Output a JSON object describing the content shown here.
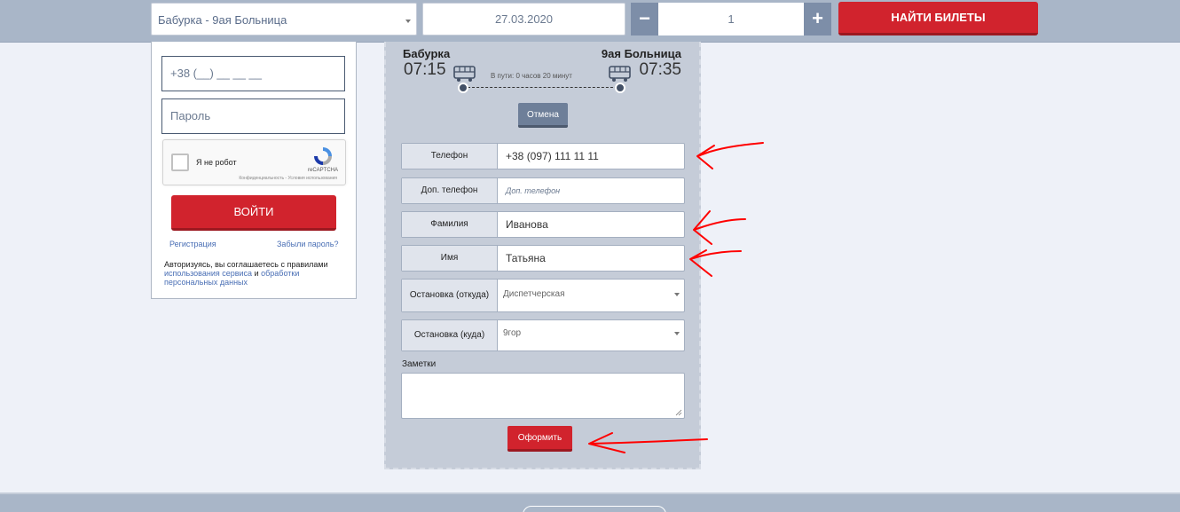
{
  "search": {
    "route": "Бабурка - 9ая Больница",
    "date": "27.03.2020",
    "quantity": "1",
    "minus": "−",
    "plus": "+",
    "find_label": "НАЙТИ БИЛЕТЫ"
  },
  "login": {
    "phone_placeholder": "+38 (__) __ __ __",
    "password_placeholder": "Пароль",
    "captcha_label": "Я не робот",
    "captcha_brand": "reCAPTCHA",
    "captcha_terms": "Конфиденциальность - Условия использования",
    "submit_label": "ВОЙТИ",
    "register_link": "Регистрация",
    "forgot_link": "Забыли пароль?",
    "agree_text": "Авторизуясь, вы соглашаетесь с правилами",
    "agree_link1": "использования сервиса",
    "agree_and": "и",
    "agree_link2": "обработки персональных данных"
  },
  "trip": {
    "from": "Бабурка",
    "to": "9ая Больница",
    "departure": "07:15",
    "arrival": "07:35",
    "duration": "В пути: 0 часов 20 минут",
    "cancel_label": "Отмена"
  },
  "form": {
    "phone_label": "Телефон",
    "phone_value": "+38 (097) 111 11 11",
    "phone2_label": "Доп. телефон",
    "phone2_placeholder": "Доп. телефон",
    "lastname_label": "Фамилия",
    "lastname_value": "Иванова",
    "firstname_label": "Имя",
    "firstname_value": "Татьяна",
    "stop_from_label": "Остановка (откуда)",
    "stop_from_value": "Диспетчерская",
    "stop_to_label": "Остановка (куда)",
    "stop_to_value": "9гор",
    "notes_label": "Заметки",
    "submit_label": "Оформить"
  },
  "colors": {
    "accent_red": "#d1232d",
    "header_bg": "#a9b6c8",
    "panel_bg": "#c5ccd8",
    "annotation_red": "#ff0000"
  }
}
